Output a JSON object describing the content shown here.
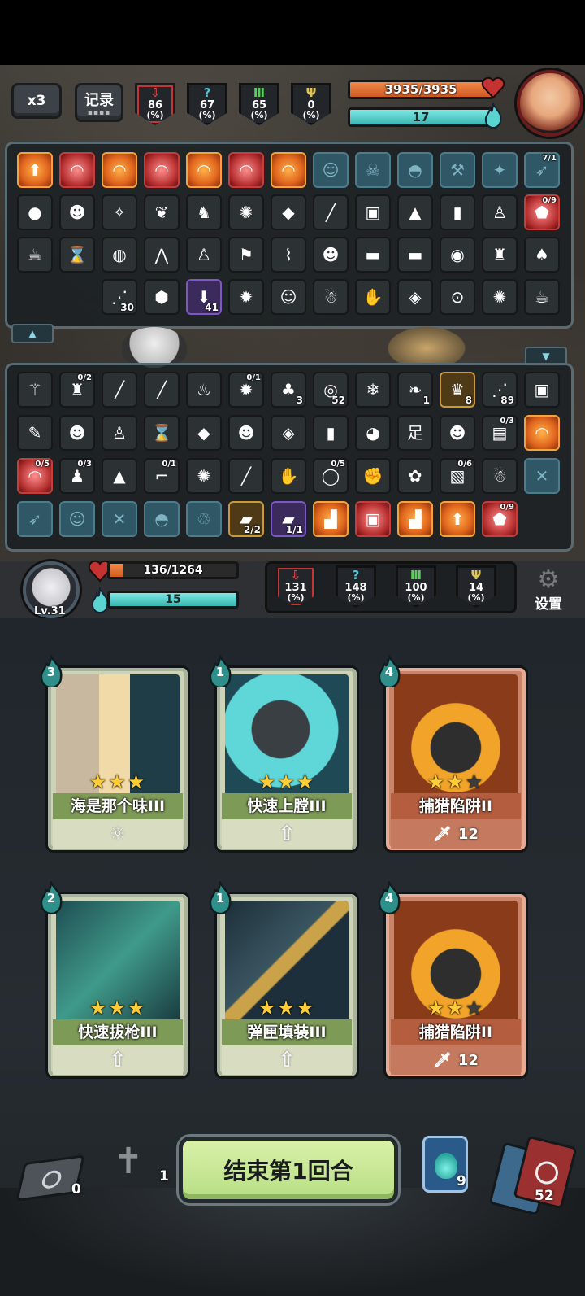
{
  "top_bar": {
    "speed": "x3",
    "record": "记录",
    "record_dots": "▪▪▪▪"
  },
  "enemy": {
    "stats": [
      {
        "icon": "sword-down-icon",
        "glyph": "⇩",
        "value": "86",
        "unit": "(%)",
        "tone": "red"
      },
      {
        "icon": "question-icon",
        "glyph": "?",
        "value": "67",
        "unit": "(%)",
        "tone": "cyan"
      },
      {
        "icon": "pillar-icon",
        "glyph": "Ⅲ",
        "value": "65",
        "unit": "(%)",
        "tone": "green"
      },
      {
        "icon": "trophy-icon",
        "glyph": "Ψ",
        "value": "0",
        "unit": "(%)",
        "tone": "gold"
      }
    ],
    "hp": "3935/3935",
    "hp_fraction": 1.0,
    "energy": "17",
    "energy_fraction": 1.0
  },
  "enemy_inventory": {
    "rows": [
      [
        {
          "t": "orange",
          "g": "⬆"
        },
        {
          "t": "red",
          "g": "◠"
        },
        {
          "t": "orange",
          "g": "◠"
        },
        {
          "t": "red",
          "g": "◠"
        },
        {
          "t": "orange",
          "g": "◠"
        },
        {
          "t": "red",
          "g": "◠"
        },
        {
          "t": "orange",
          "g": "◠"
        },
        {
          "t": "blue",
          "g": "☺"
        },
        {
          "t": "blue",
          "g": "☠"
        },
        {
          "t": "blue",
          "g": "◓"
        },
        {
          "t": "blue",
          "g": "⚒"
        },
        {
          "t": "blue",
          "g": "✦"
        },
        {
          "t": "blue",
          "g": "➶",
          "b": "7/1"
        }
      ],
      [
        {
          "t": "dark",
          "g": "●"
        },
        {
          "t": "dark",
          "g": "☻"
        },
        {
          "t": "dark",
          "g": "✧"
        },
        {
          "t": "dark",
          "g": "❦"
        },
        {
          "t": "dark",
          "g": "♞"
        },
        {
          "t": "dark",
          "g": "✺"
        },
        {
          "t": "dark",
          "g": "◆"
        },
        {
          "t": "dark",
          "g": "╱"
        },
        {
          "t": "dark",
          "g": "▣"
        },
        {
          "t": "dark",
          "g": "▲"
        },
        {
          "t": "dark",
          "g": "▮"
        },
        {
          "t": "dark",
          "g": "♙"
        },
        {
          "t": "red",
          "g": "⬟",
          "b": "0/9"
        }
      ],
      [
        {
          "t": "dark",
          "g": "☕"
        },
        {
          "t": "dark",
          "g": "⌛"
        },
        {
          "t": "dark",
          "g": "◍"
        },
        {
          "t": "dark",
          "g": "⋀"
        },
        {
          "t": "dark",
          "g": "♙"
        },
        {
          "t": "dark",
          "g": "⚑"
        },
        {
          "t": "dark",
          "g": "⌇"
        },
        {
          "t": "dark",
          "g": "☻"
        },
        {
          "t": "dark",
          "g": "▬"
        },
        {
          "t": "dark",
          "g": "▬"
        },
        {
          "t": "dark",
          "g": "◉"
        },
        {
          "t": "dark",
          "g": "♜"
        },
        {
          "t": "dark",
          "g": "♠"
        }
      ],
      [
        {
          "t": "none"
        },
        {
          "t": "none"
        },
        {
          "t": "dark",
          "g": "⋰",
          "c": "30"
        },
        {
          "t": "dark",
          "g": "⬢"
        },
        {
          "t": "purple",
          "g": "⬇",
          "c": "41"
        },
        {
          "t": "dark",
          "g": "✹"
        },
        {
          "t": "dark",
          "g": "☺"
        },
        {
          "t": "dark",
          "g": "☃"
        },
        {
          "t": "dark",
          "g": "✋"
        },
        {
          "t": "dark",
          "g": "◈"
        },
        {
          "t": "dark",
          "g": "⊙"
        },
        {
          "t": "dark",
          "g": "✺"
        },
        {
          "t": "dark",
          "g": "☕"
        }
      ]
    ],
    "collapse": "▲"
  },
  "player_inventory": {
    "expand": "▼",
    "rows": [
      [
        {
          "t": "dark",
          "g": "⚚"
        },
        {
          "t": "dark",
          "g": "♜",
          "b": "0/2"
        },
        {
          "t": "dark",
          "g": "╱"
        },
        {
          "t": "dark",
          "g": "╱"
        },
        {
          "t": "dark",
          "g": "♨"
        },
        {
          "t": "dark",
          "g": "✹",
          "b": "0/1"
        },
        {
          "t": "dark",
          "g": "♣",
          "c": "3"
        },
        {
          "t": "dark",
          "g": "◎",
          "c": "52"
        },
        {
          "t": "dark",
          "g": "❄"
        },
        {
          "t": "dark",
          "g": "❧",
          "c": "1"
        },
        {
          "t": "gold",
          "g": "♛",
          "c": "8"
        },
        {
          "t": "dark",
          "g": "⋰",
          "c": "89"
        }
      ],
      [
        {
          "t": "dark",
          "g": "▣"
        },
        {
          "t": "dark",
          "g": "✎"
        },
        {
          "t": "dark",
          "g": "☻"
        },
        {
          "t": "dark",
          "g": "♙"
        },
        {
          "t": "dark",
          "g": "⌛"
        },
        {
          "t": "dark",
          "g": "◆"
        },
        {
          "t": "dark",
          "g": "☻"
        },
        {
          "t": "dark",
          "g": "◈"
        },
        {
          "t": "dark",
          "g": "▮"
        },
        {
          "t": "dark",
          "g": "◕"
        },
        {
          "t": "dark",
          "g": "足"
        },
        {
          "t": "dark",
          "g": "☻"
        },
        {
          "t": "dark",
          "g": "▤",
          "b": "0/3"
        }
      ],
      [
        {
          "t": "orange",
          "g": "◠"
        },
        {
          "t": "red",
          "g": "◠",
          "b": "0/5"
        },
        {
          "t": "dark",
          "g": "♟",
          "b": "0/3"
        },
        {
          "t": "dark",
          "g": "▲"
        },
        {
          "t": "dark",
          "g": "⌐",
          "b": "0/1"
        },
        {
          "t": "dark",
          "g": "✺"
        },
        {
          "t": "dark",
          "g": "╱"
        },
        {
          "t": "dark",
          "g": "✋"
        },
        {
          "t": "dark",
          "g": "◯",
          "b": "0/5"
        },
        {
          "t": "dark",
          "g": "✊"
        },
        {
          "t": "dark",
          "g": "✿"
        },
        {
          "t": "dark",
          "g": "▧",
          "b": "0/6"
        },
        {
          "t": "dark",
          "g": "☃"
        }
      ],
      [
        {
          "t": "blue",
          "g": "✕"
        },
        {
          "t": "blue",
          "g": "➶"
        },
        {
          "t": "blue",
          "g": "☺"
        },
        {
          "t": "blue",
          "g": "✕"
        },
        {
          "t": "blue",
          "g": "◓"
        },
        {
          "t": "blue",
          "g": "♲"
        },
        {
          "t": "gold",
          "g": "▰",
          "c": "2/2"
        },
        {
          "t": "purple",
          "g": "▰",
          "c": "1/1"
        },
        {
          "t": "orange",
          "g": "▟"
        },
        {
          "t": "red",
          "g": "▣"
        },
        {
          "t": "orange",
          "g": "▟"
        },
        {
          "t": "orange",
          "g": "⬆"
        },
        {
          "t": "red",
          "g": "⬟",
          "b": "0/9"
        }
      ]
    ]
  },
  "player": {
    "level": "Lv.31",
    "hp": "136/1264",
    "hp_fraction": 0.11,
    "energy": "15",
    "energy_fraction": 1.0,
    "stats": [
      {
        "icon": "sword-down-icon",
        "glyph": "⇩",
        "value": "131",
        "unit": "(%)",
        "tone": "red"
      },
      {
        "icon": "question-icon",
        "glyph": "?",
        "value": "148",
        "unit": "(%)",
        "tone": "cyan"
      },
      {
        "icon": "pillar-icon",
        "glyph": "Ⅲ",
        "value": "100",
        "unit": "(%)",
        "tone": "green"
      },
      {
        "icon": "trophy-icon",
        "glyph": "Ψ",
        "value": "14",
        "unit": "(%)",
        "tone": "gold"
      }
    ],
    "settings": "设置"
  },
  "hand": [
    {
      "cost": "3",
      "name": "海是那个味III",
      "stars": 3,
      "max_stars": 3,
      "tone": "green",
      "foot": "whistle-icon",
      "foot_value": "",
      "art": "face"
    },
    {
      "cost": "1",
      "name": "快速上膛III",
      "stars": 3,
      "max_stars": 3,
      "tone": "green",
      "foot": "upgrade-arrow-icon",
      "foot_value": "",
      "art": "ball"
    },
    {
      "cost": "4",
      "name": "捕猎陷阱II",
      "stars": 2,
      "max_stars": 3,
      "tone": "red",
      "foot": "knife-icon",
      "foot_value": "12",
      "art": "trap"
    },
    {
      "cost": "2",
      "name": "快速拔枪III",
      "stars": 3,
      "max_stars": 3,
      "tone": "green",
      "foot": "upgrade-arrow-icon",
      "foot_value": "",
      "art": "gunner"
    },
    {
      "cost": "1",
      "name": "弹匣填装III",
      "stars": 3,
      "max_stars": 3,
      "tone": "green",
      "foot": "upgrade-arrow-icon",
      "foot_value": "",
      "art": "bullet"
    },
    {
      "cost": "4",
      "name": "捕猎陷阱II",
      "stars": 2,
      "max_stars": 3,
      "tone": "red",
      "foot": "knife-icon",
      "foot_value": "12",
      "art": "trap"
    }
  ],
  "bottom": {
    "end_turn": "结束第1回合",
    "discard_count": "0",
    "grave_count": "1",
    "potion_count": "9",
    "draw_count": "52"
  }
}
